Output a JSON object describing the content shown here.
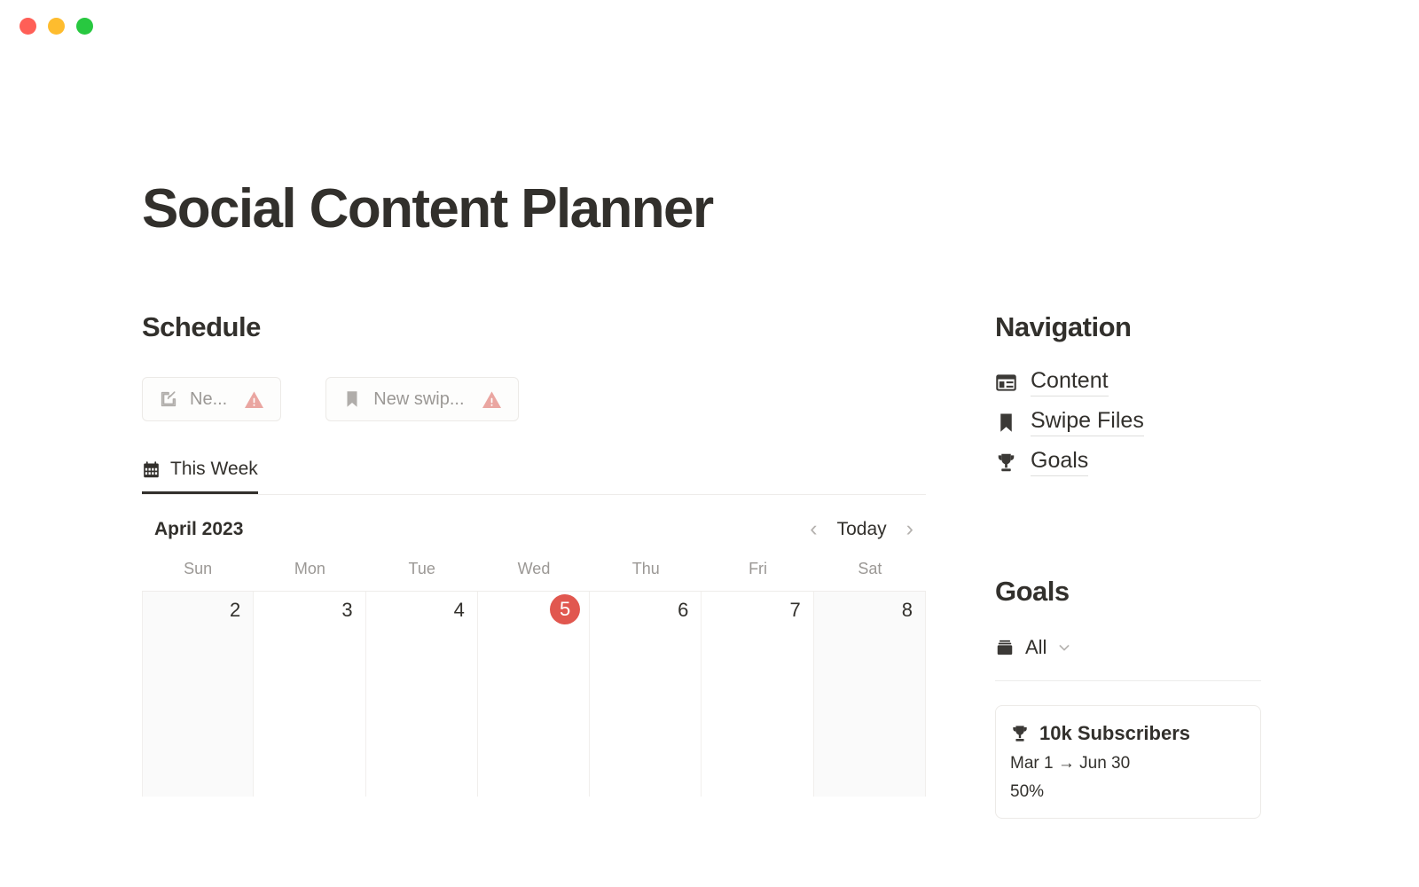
{
  "window": {
    "traffic_lights": [
      {
        "name": "close",
        "color": "#ff5f57"
      },
      {
        "name": "minimize",
        "color": "#febc2e"
      },
      {
        "name": "maximize",
        "color": "#28c840"
      }
    ]
  },
  "page": {
    "title": "Social Content Planner"
  },
  "schedule": {
    "heading": "Schedule",
    "buttons": [
      {
        "icon": "edit-icon",
        "label": "Ne...",
        "status_icon": "warning-icon"
      },
      {
        "icon": "bookmark-icon",
        "label": "New swip...",
        "status_icon": "warning-icon"
      }
    ],
    "tabs": [
      {
        "icon": "calendar-icon",
        "label": "This Week",
        "active": true
      }
    ],
    "calendar": {
      "month": "April 2023",
      "prev_label": "‹",
      "today_label": "Today",
      "next_label": "›",
      "day_names": [
        "Sun",
        "Mon",
        "Tue",
        "Wed",
        "Thu",
        "Fri",
        "Sat"
      ],
      "days": [
        {
          "date": "2",
          "today": false,
          "weekend": true
        },
        {
          "date": "3",
          "today": false,
          "weekend": false
        },
        {
          "date": "4",
          "today": false,
          "weekend": false
        },
        {
          "date": "5",
          "today": true,
          "weekend": false
        },
        {
          "date": "6",
          "today": false,
          "weekend": false
        },
        {
          "date": "7",
          "today": false,
          "weekend": false
        },
        {
          "date": "8",
          "today": false,
          "weekend": true
        }
      ],
      "today_color": "#e1574f"
    }
  },
  "navigation": {
    "heading": "Navigation",
    "items": [
      {
        "icon": "gallery-icon",
        "label": "Content"
      },
      {
        "icon": "bookmark-icon",
        "label": "Swipe Files"
      },
      {
        "icon": "trophy-icon",
        "label": "Goals"
      }
    ]
  },
  "goals": {
    "heading": "Goals",
    "filter": {
      "icon": "database-icon",
      "label": "All",
      "chevron": "chevron-down-icon"
    },
    "cards": [
      {
        "icon": "trophy-icon",
        "title": "10k Subscribers",
        "dates": "Mar 1 → Jun 30",
        "progress": "50%"
      }
    ]
  }
}
